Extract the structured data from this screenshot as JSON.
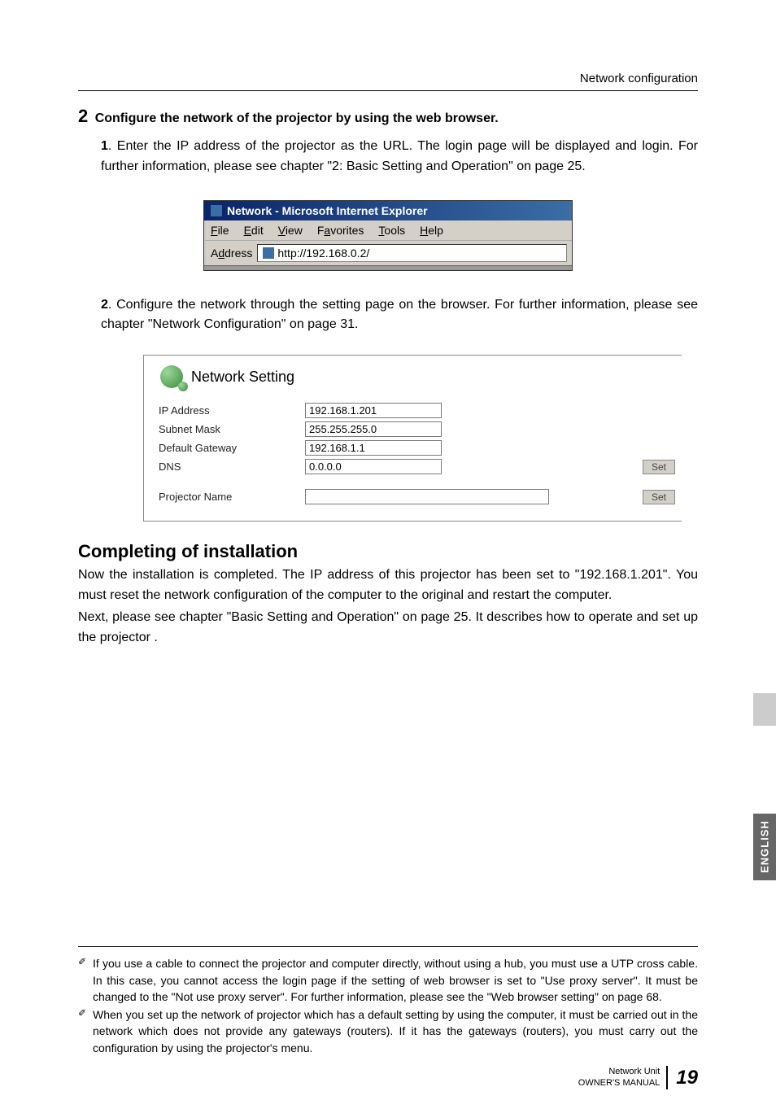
{
  "header": {
    "title": "Network configuration"
  },
  "step2": {
    "num": "2",
    "text": "Configure the network of the projector by using the web browser.",
    "sub1_num": "1",
    "sub1_body": "Enter the IP address of the projector as the URL. The login page will be displayed and login. For further information, please see chapter \"2: Basic Setting and Operation\" on page 25.",
    "sub2_num": "2",
    "sub2_body": "Configure the network through the setting page on the browser. For further information, please see chapter \"Network Configuration\" on page 31."
  },
  "ie": {
    "title": "Network - Microsoft Internet Explorer",
    "menu": {
      "file": "File",
      "edit": "Edit",
      "view": "View",
      "favorites": "Favorites",
      "tools": "Tools",
      "help": "Help"
    },
    "address_label": "Address",
    "url": "http://192.168.0.2/"
  },
  "panel": {
    "title": "Network Setting",
    "ip_label": "IP Address",
    "ip_value": "192.168.1.201",
    "mask_label": "Subnet Mask",
    "mask_value": "255.255.255.0",
    "gw_label": "Default Gateway",
    "gw_value": "192.168.1.1",
    "dns_label": "DNS",
    "dns_value": "0.0.0.0",
    "pname_label": "Projector Name",
    "pname_value": "",
    "set_btn": "Set"
  },
  "completing": {
    "heading": "Completing of installation",
    "p1": "Now the installation is completed. The IP address of this projector has been set to \"192.168.1.201\". You must reset the network configuration of the computer to the original and restart the computer.",
    "p2": "Next, please see chapter \"Basic Setting and Operation\" on page 25. It describes how to operate and set up the projector ."
  },
  "sidetab": "ENGLISH",
  "footnotes": {
    "n1": "If you use a cable to connect the projector and computer directly, without using a hub, you must use a UTP cross cable. In this case, you cannot access the login page if the setting of web browser is set to \"Use proxy server\". It must be changed to the \"Not use proxy server\". For further information, please see the \"Web browser setting\" on page 68.",
    "n2": "When you set up the network of projector which has a default setting by using the computer, it must be carried out in the network which does not provide any gateways (routers). If it has the gateways (routers), you must carry out the configuration by using the projector's menu."
  },
  "footer": {
    "line1": "Network Unit",
    "line2": "OWNER'S MANUAL",
    "page": "19"
  }
}
